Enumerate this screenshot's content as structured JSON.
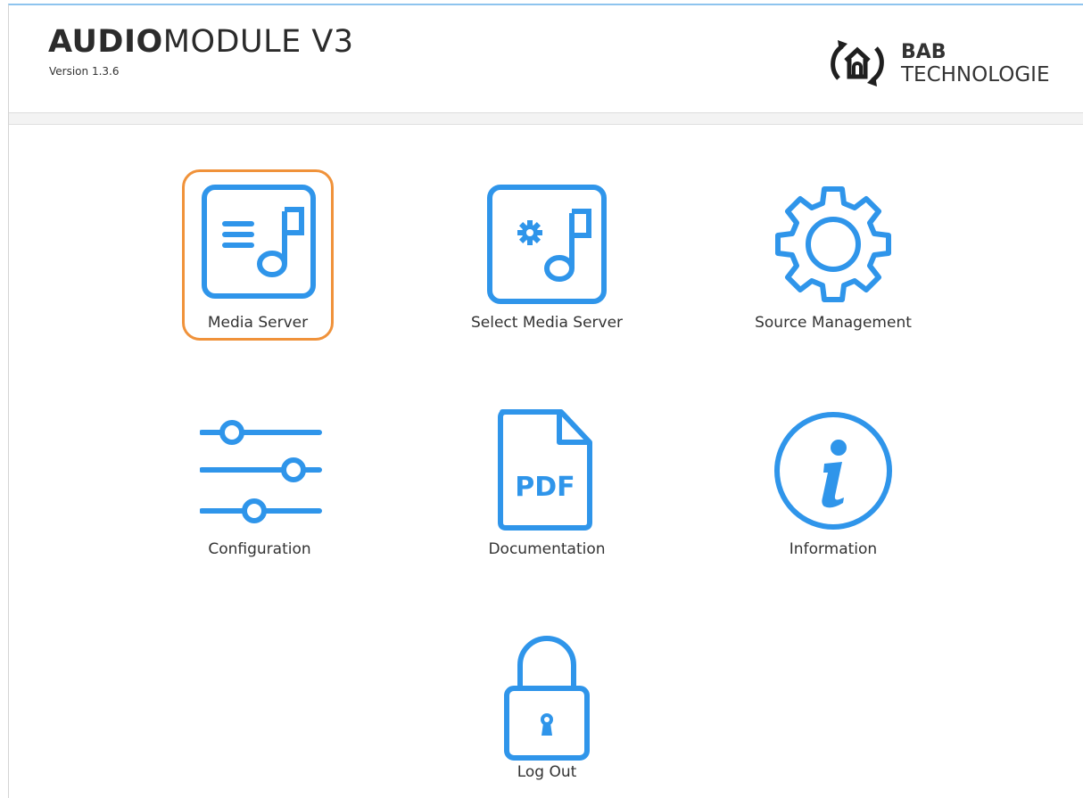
{
  "header": {
    "title_bold": "AUDIO",
    "title_light": "MODULE V3",
    "version": "Version 1.3.6",
    "logo": {
      "icon": "bab-house-logo-icon",
      "line1": "BAB",
      "line2": "TECHNOLOGIE"
    }
  },
  "colors": {
    "accent": "#2f95ea",
    "selection": "#f0923a"
  },
  "tiles": [
    {
      "label": "Media Server",
      "icon": "music-list-icon",
      "selected": true
    },
    {
      "label": "Select Media Server",
      "icon": "music-gear-icon",
      "selected": false
    },
    {
      "label": "Source Management",
      "icon": "gear-icon",
      "selected": false
    },
    {
      "label": "Configuration",
      "icon": "sliders-icon",
      "selected": false
    },
    {
      "label": "Documentation",
      "icon": "pdf-document-icon",
      "icon_text": "PDF",
      "selected": false
    },
    {
      "label": "Information",
      "icon": "info-icon",
      "selected": false
    },
    {
      "label": "Log Out",
      "icon": "lock-icon",
      "selected": false
    }
  ]
}
